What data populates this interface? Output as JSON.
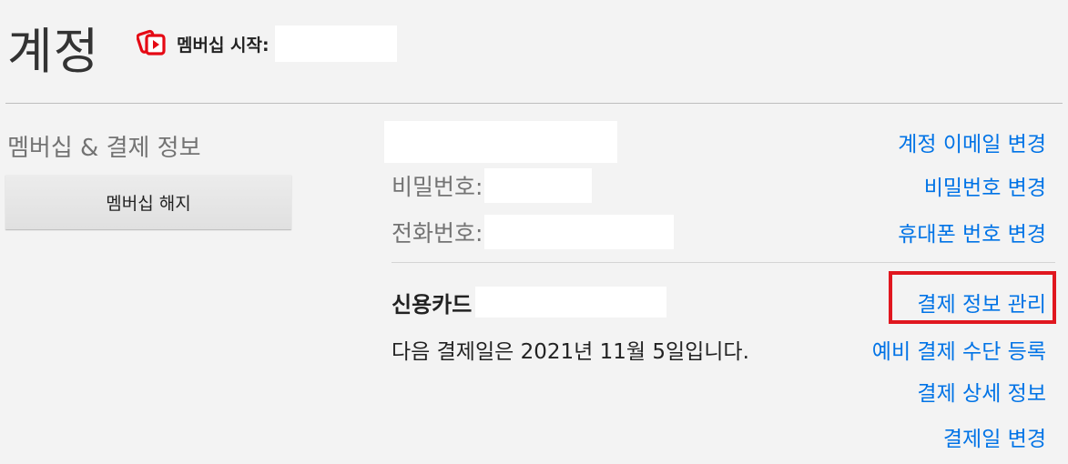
{
  "header": {
    "title": "계정",
    "member_since_label": "멤버십 시작:"
  },
  "membership": {
    "section_heading": "멤버십 & 결제 정보",
    "cancel_button": "멤버십 해지"
  },
  "account": {
    "password_label": "비밀번호:",
    "phone_label": "전화번호:",
    "links": {
      "change_email": "계정 이메일 변경",
      "change_password": "비밀번호 변경",
      "change_phone": "휴대폰 번호 변경"
    }
  },
  "billing": {
    "card_type": "신용카드",
    "next_billing": "다음 결제일은 2021년 11월 5일입니다.",
    "links": {
      "manage_payment": "결제 정보 관리",
      "backup_payment": "예비 결제 수단 등록",
      "billing_details": "결제 상세 정보",
      "change_billing_date": "결제일 변경"
    }
  },
  "colors": {
    "link": "#0073e6",
    "highlight": "#e0171f",
    "icon": "#e50914"
  },
  "icons": {
    "membership": "membership-play-icon"
  }
}
